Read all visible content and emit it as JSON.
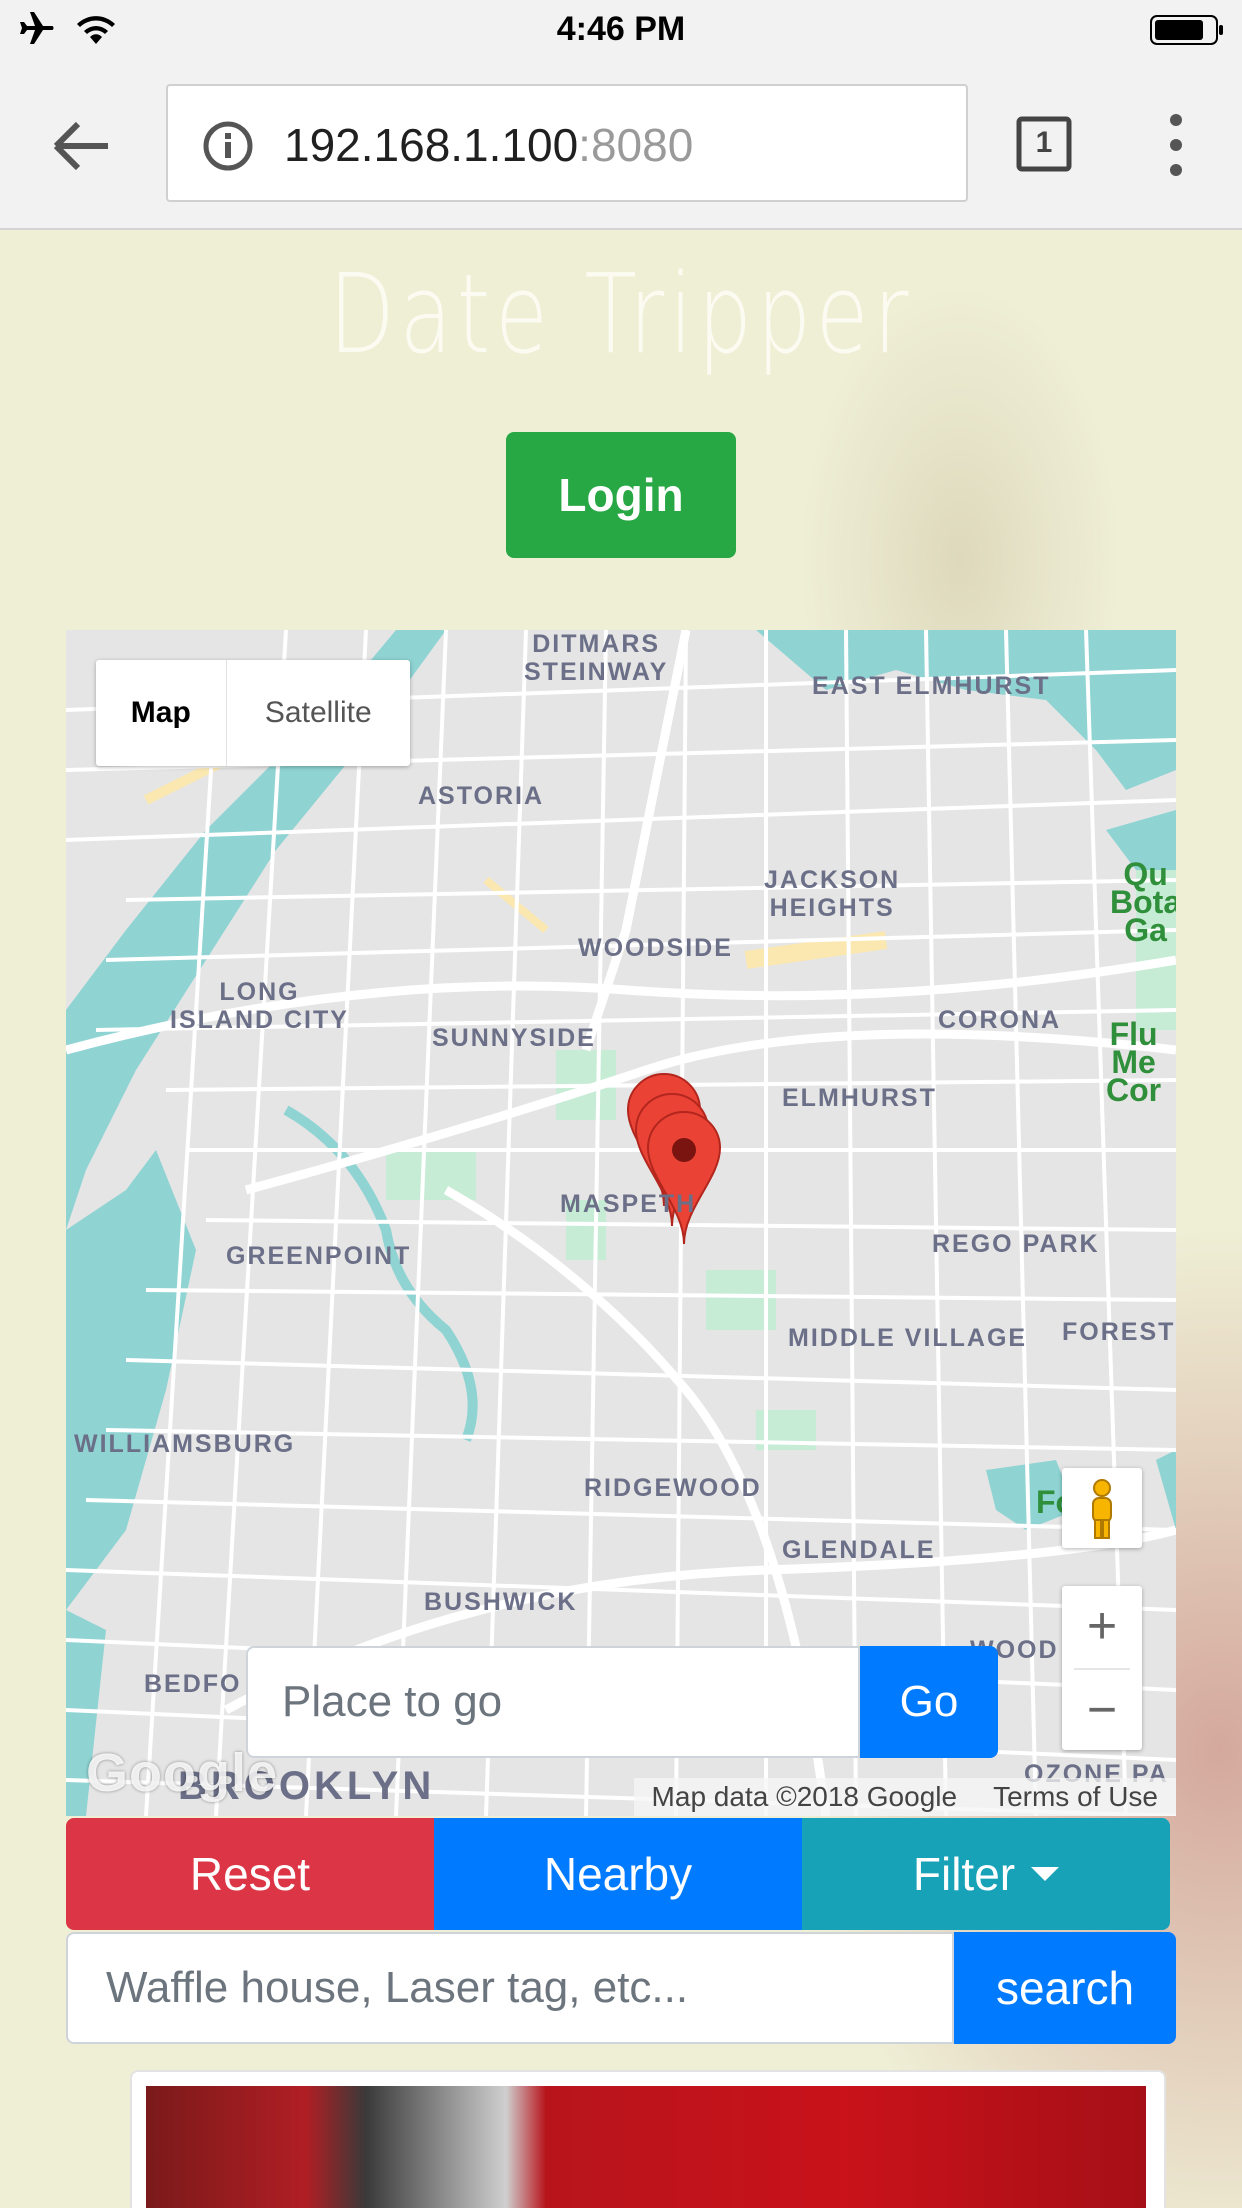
{
  "status_bar": {
    "time": "4:46 PM"
  },
  "browser": {
    "url_host": "192.168.1.100",
    "url_port": ":8080",
    "tab_count": "1"
  },
  "site": {
    "title": "Date Tripper",
    "login_label": "Login"
  },
  "map": {
    "type_map_label": "Map",
    "type_satellite_label": "Satellite",
    "labels": [
      {
        "name": "ditmars",
        "text": "DITMARS\nSTEINWAY"
      },
      {
        "name": "east-elmhurst",
        "text": "EAST ELMHURST"
      },
      {
        "name": "astoria",
        "text": "ASTORIA"
      },
      {
        "name": "jackson-heights",
        "text": "JACKSON\nHEIGHTS"
      },
      {
        "name": "woodside",
        "text": "WOODSIDE"
      },
      {
        "name": "long-island-city",
        "text": "LONG\nISLAND CITY"
      },
      {
        "name": "sunnyside",
        "text": "SUNNYSIDE"
      },
      {
        "name": "corona",
        "text": "CORONA"
      },
      {
        "name": "elmhurst",
        "text": "ELMHURST"
      },
      {
        "name": "maspeth",
        "text": "MASPETH"
      },
      {
        "name": "greenpoint",
        "text": "GREENPOINT"
      },
      {
        "name": "rego-park",
        "text": "REGO PARK"
      },
      {
        "name": "middle-village",
        "text": "MIDDLE VILLAGE"
      },
      {
        "name": "forest",
        "text": "FOREST"
      },
      {
        "name": "williamsburg",
        "text": "WILLIAMSBURG"
      },
      {
        "name": "ridgewood",
        "text": "RIDGEWOOD"
      },
      {
        "name": "glendale",
        "text": "GLENDALE"
      },
      {
        "name": "bushwick",
        "text": "BUSHWICK"
      },
      {
        "name": "bedford",
        "text": "BEDFO"
      },
      {
        "name": "wood",
        "text": "WOOD"
      },
      {
        "name": "ozone",
        "text": "OZONE PA"
      }
    ],
    "park_labels": [
      {
        "name": "queens-botanical",
        "text": "Qu\nBota\nGa"
      },
      {
        "name": "flushing-meadows",
        "text": "Flu\nMe\nCor"
      },
      {
        "name": "fp",
        "text": "Fo   P"
      }
    ],
    "brooklyn": "BROOKLYN",
    "google": "Google",
    "attribution": "Map data ©2018 Google",
    "terms": "Terms of Use",
    "zoom_in": "+",
    "zoom_out": "−",
    "place_placeholder": "Place to go",
    "go_label": "Go",
    "marker_count": 3
  },
  "actions": {
    "reset": "Reset",
    "nearby": "Nearby",
    "filter": "Filter"
  },
  "search": {
    "placeholder": "Waffle house, Laser tag, etc...",
    "button": "search"
  },
  "colors": {
    "login": "#28a745",
    "primary": "#007bff",
    "danger": "#dc3545",
    "info": "#17a2b8",
    "marker": "#ea4335",
    "water": "#8fd3d3"
  }
}
